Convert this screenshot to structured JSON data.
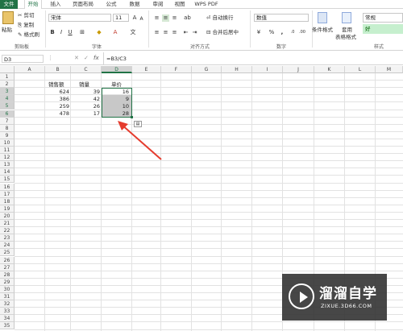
{
  "tabs": [
    "文件",
    "开始",
    "插入",
    "页面布局",
    "公式",
    "数据",
    "审阅",
    "视图",
    "WPS PDF"
  ],
  "clipboard": {
    "paste": "粘贴",
    "cut": "剪切",
    "copy": "复制",
    "format_painter": "格式刷",
    "group": "剪贴板"
  },
  "font": {
    "name": "宋体",
    "size": "11",
    "bold": "B",
    "italic": "I",
    "underline": "U",
    "grow": "A",
    "shrink": "A",
    "group": "字体"
  },
  "alignment": {
    "wrap": "自动换行",
    "merge": "合并后居中",
    "group": "对齐方式"
  },
  "number": {
    "format": "数值",
    "percent": "%",
    "comma": ",",
    "group": "数字"
  },
  "styles": {
    "conditional": "条件格式",
    "table_format_1": "套用",
    "table_format_2": "表格格式",
    "normal": "常规",
    "good": "好",
    "group": "样式"
  },
  "formula_bar": {
    "name_box": "D3",
    "fx": "fx",
    "formula": "=B3/C3"
  },
  "columns": [
    "A",
    "B",
    "C",
    "D",
    "E",
    "F",
    "G",
    "H",
    "I",
    "J",
    "K",
    "L",
    "M"
  ],
  "rows": [
    "1",
    "2",
    "3",
    "4",
    "5",
    "6",
    "7",
    "8",
    "9",
    "10",
    "11",
    "12",
    "13",
    "14",
    "15",
    "16",
    "17",
    "18",
    "19",
    "20",
    "21",
    "22",
    "23",
    "24",
    "25",
    "26",
    "27",
    "28",
    "29",
    "30",
    "31",
    "32",
    "33",
    "34",
    "35"
  ],
  "table": {
    "headers": [
      "销售额",
      "销量",
      "单价"
    ],
    "rows": [
      [
        "624",
        "39",
        "16"
      ],
      [
        "386",
        "42",
        "9"
      ],
      [
        "259",
        "26",
        "10"
      ],
      [
        "478",
        "17",
        "28"
      ]
    ]
  },
  "watermark": {
    "brand": "溜溜自学",
    "url": "ZIXUE.3D66.COM"
  },
  "colors": {
    "accent": "#217346",
    "selection": "#c8c8c8",
    "arrow": "#e53c2e"
  }
}
